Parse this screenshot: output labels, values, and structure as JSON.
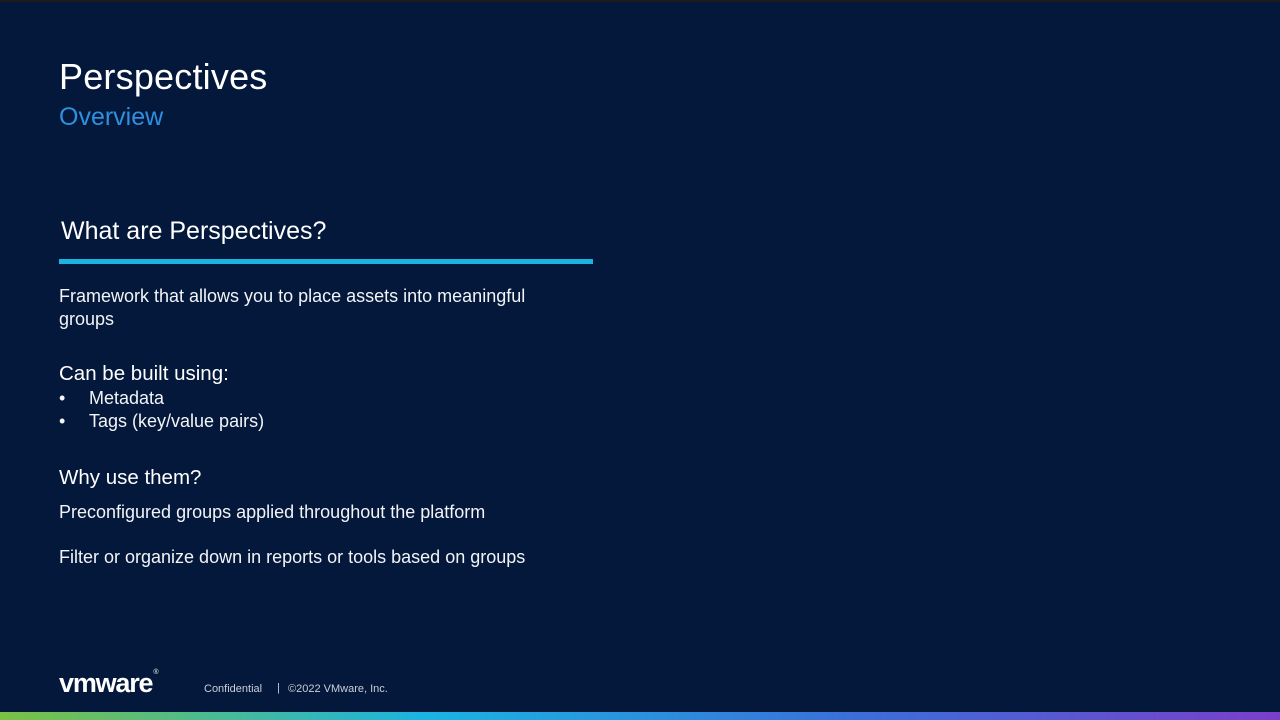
{
  "slide": {
    "title": "Perspectives",
    "subtitle": "Overview",
    "section_heading": "What are Perspectives?",
    "description": "Framework that allows you to place assets into meaningful groups",
    "built_heading": "Can be built using:",
    "built_items": [
      "Metadata",
      "Tags (key/value pairs)"
    ],
    "bullet_glyph": "•",
    "why_heading": "Why use them?",
    "why_points": [
      "Preconfigured groups applied throughout the platform",
      "Filter or organize down in reports or tools based on groups"
    ]
  },
  "footer": {
    "logo_text": "vmware",
    "logo_mark": "®",
    "confidential": "Confidential",
    "separator": "|",
    "copyright": "©2022 VMware, Inc."
  },
  "colors": {
    "background": "#03183a",
    "accent_blue": "#2f8fe0",
    "rule_cyan": "#1ab4e2",
    "bar_gradient": [
      "#7bc143",
      "#1ab4e2",
      "#3a6fd8",
      "#7a3fc9"
    ]
  }
}
